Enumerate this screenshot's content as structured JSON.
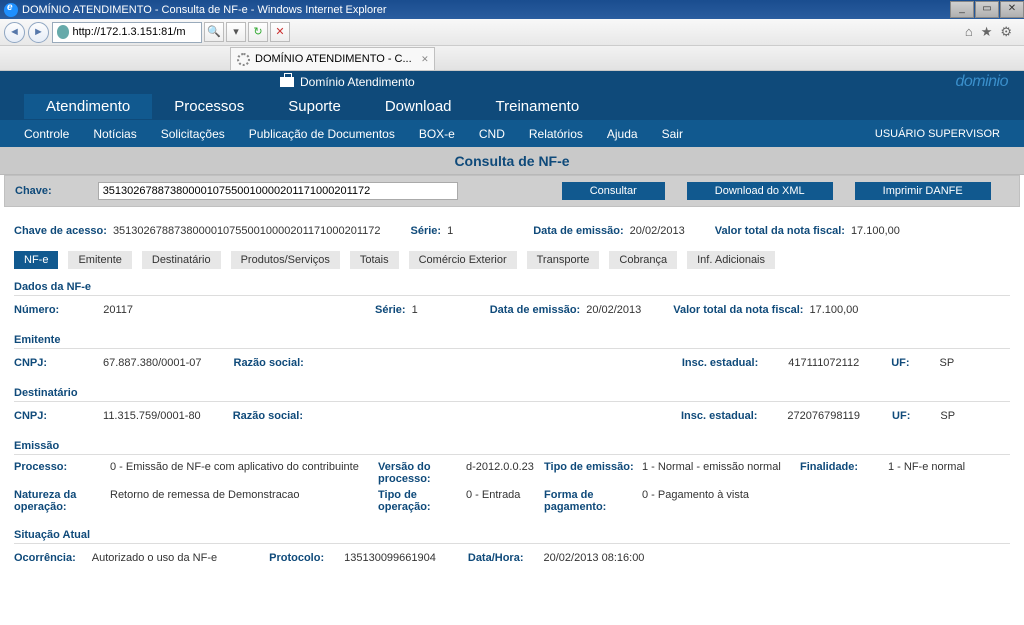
{
  "window": {
    "title": "DOMÍNIO ATENDIMENTO - Consulta de NF-e - Windows Internet Explorer"
  },
  "browser": {
    "url": "http://172.1.3.151:81/m",
    "tab_title": "DOMÍNIO ATENDIMENTO - C..."
  },
  "app": {
    "title": "Domínio Atendimento",
    "logo": "dominio"
  },
  "mainnav": [
    "Atendimento",
    "Processos",
    "Suporte",
    "Download",
    "Treinamento"
  ],
  "subnav": [
    "Controle",
    "Notícias",
    "Solicitações",
    "Publicação de Documentos",
    "BOX-e",
    "CND",
    "Relatórios",
    "Ajuda",
    "Sair"
  ],
  "user": "USUÁRIO SUPERVISOR",
  "page_title": "Consulta de NF-e",
  "search": {
    "label": "Chave:",
    "value": "35130267887380000107550010000201171000201172",
    "btn_consultar": "Consultar",
    "btn_download": "Download do XML",
    "btn_imprimir": "Imprimir DANFE"
  },
  "summary": {
    "chave_label": "Chave de acesso:",
    "chave": "35130267887380000107550010000201171000201172",
    "serie_label": "Série:",
    "serie": "1",
    "data_label": "Data de emissão:",
    "data": "20/02/2013",
    "valor_label": "Valor total da nota fiscal:",
    "valor": "17.100,00"
  },
  "tabs": [
    "NF-e",
    "Emitente",
    "Destinatário",
    "Produtos/Serviços",
    "Totais",
    "Comércio Exterior",
    "Transporte",
    "Cobrança",
    "Inf. Adicionais"
  ],
  "dados": {
    "head": "Dados da NF-e",
    "numero_label": "Número:",
    "numero": "20117",
    "serie_label": "Série:",
    "serie": "1",
    "data_label": "Data de emissão:",
    "data": "20/02/2013",
    "valor_label": "Valor total da nota fiscal:",
    "valor": "17.100,00"
  },
  "emitente": {
    "head": "Emitente",
    "cnpj_label": "CNPJ:",
    "cnpj": "67.887.380/0001-07",
    "razao_label": "Razão social:",
    "razao": "",
    "insc_label": "Insc. estadual:",
    "insc": "417111072112",
    "uf_label": "UF:",
    "uf": "SP"
  },
  "dest": {
    "head": "Destinatário",
    "cnpj_label": "CNPJ:",
    "cnpj": "11.315.759/0001-80",
    "razao_label": "Razão social:",
    "razao": "",
    "insc_label": "Insc. estadual:",
    "insc": "272076798119",
    "uf_label": "UF:",
    "uf": "SP"
  },
  "emissao": {
    "head": "Emissão",
    "processo_label": "Processo:",
    "processo": "0 - Emissão de NF-e com aplicativo do contribuinte",
    "versao_label": "Versão do processo:",
    "versao": "d-2012.0.0.23",
    "tipo_em_label": "Tipo de emissão:",
    "tipo_em": "1 - Normal - emissão normal",
    "finalidade_label": "Finalidade:",
    "finalidade": "1 - NF-e normal",
    "natureza_label": "Natureza da operação:",
    "natureza": "Retorno de remessa de Demonstracao",
    "tipo_op_label": "Tipo de operação:",
    "tipo_op": "0 - Entrada",
    "forma_label": "Forma de pagamento:",
    "forma": "0 - Pagamento à vista"
  },
  "situacao": {
    "head": "Situação Atual",
    "ocorr_label": "Ocorrência:",
    "ocorr": "Autorizado o uso da NF-e",
    "proto_label": "Protocolo:",
    "proto": "135130099661904",
    "dh_label": "Data/Hora:",
    "dh": "20/02/2013 08:16:00"
  }
}
